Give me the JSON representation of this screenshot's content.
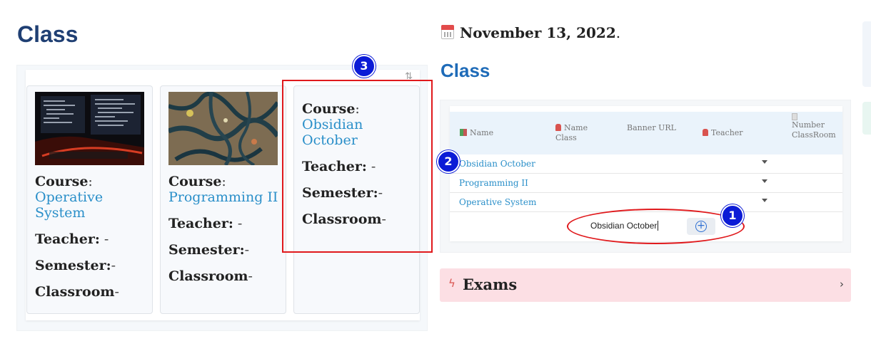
{
  "left": {
    "heading": "Class",
    "sort_icon": "sort-arrows-icon",
    "cards": [
      {
        "course_label": "Course",
        "course_value": "Operative System",
        "teacher_label": "Teacher:",
        "teacher_value": "-",
        "semester_label": "Semester:",
        "semester_value": "-",
        "classroom_label": "Classroom",
        "classroom_value": "-"
      },
      {
        "course_label": "Course",
        "course_value": "Programming II",
        "teacher_label": "Teacher:",
        "teacher_value": "-",
        "semester_label": "Semester:",
        "semester_value": "-",
        "classroom_label": "Classroom",
        "classroom_value": "-"
      },
      {
        "course_label": "Course",
        "course_value": "Obsidian October",
        "teacher_label": "Teacher:",
        "teacher_value": "-",
        "semester_label": "Semester:",
        "semester_value": "-",
        "classroom_label": "Classroom",
        "classroom_value": "-"
      }
    ]
  },
  "right": {
    "date_icon": "calendar-icon",
    "date": "November 13, 2022",
    "date_suffix": ".",
    "heading": "Class",
    "table": {
      "columns": {
        "name": "Name",
        "name_class_1": "Name",
        "name_class_2": "Class",
        "banner": "Banner URL",
        "teacher": "Teacher",
        "number_1": "Number",
        "number_2": "ClassRoom"
      },
      "rows": [
        {
          "name": "Obsidian October"
        },
        {
          "name": "Programming II"
        },
        {
          "name": "Operative System"
        }
      ],
      "new_entry_value": "Obsidian October"
    },
    "exams": {
      "icon": "lightning-icon",
      "title": "Exams",
      "chevron": "chevron-right-icon"
    }
  },
  "annotations": {
    "badge_1": "1",
    "badge_2": "2",
    "badge_3": "3",
    "rect_color": "#e0191c",
    "badge_color": "#0b1bd6"
  },
  "colors": {
    "left_heading": "#1f3f73",
    "right_heading": "#1e6bb8",
    "link": "#2a8fc9",
    "exams_bg": "#fcdfe4"
  }
}
